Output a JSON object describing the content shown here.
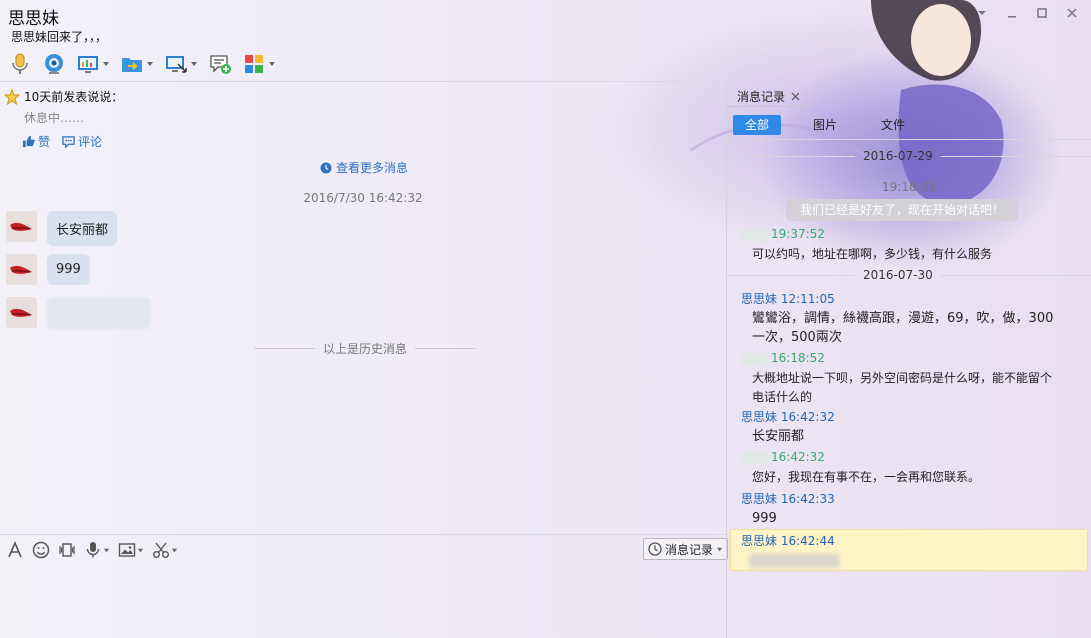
{
  "window": {
    "title": "思思妹",
    "status": "思思妹回来了，，，"
  },
  "feed": {
    "title": "10天前发表说说：",
    "text": "休息中……",
    "like_label": "赞",
    "comment_label": "评论"
  },
  "chat": {
    "more_messages_label": "查看更多消息",
    "timestamp": "2016/7/30 16:42:32",
    "messages": [
      {
        "text": "长安丽都"
      },
      {
        "text": "999"
      }
    ],
    "history_divider": "以上是历史消息"
  },
  "input": {
    "history_button_label": "消息记录"
  },
  "history_panel": {
    "tab_label": "消息记录",
    "filters": [
      "全部",
      "图片",
      "文件"
    ],
    "active_filter": "全部",
    "entries": {
      "date1": "2016-07-29",
      "sys_time": "19:18:33",
      "sys_note": "我们已经是好友了，现在开始对话吧！",
      "m1_time": "19:37:52",
      "m1_text": "可以约吗，地址在哪啊，多少钱，有什么服务",
      "date2": "2016-07-30",
      "m2_name": "思思妹",
      "m2_time": "12:11:05",
      "m2_text": "鸞鸞浴，調情，絲襪高跟，漫遊，69，吹，做，300一次，500兩次",
      "m3_time": "16:18:52",
      "m3_text": "大概地址说一下呗，另外空间密码是什么呀，能不能留个电话什么的",
      "m4_name": "思思妹",
      "m4_time": "16:42:32",
      "m4_text": "长安丽都",
      "m5_time": "16:42:32",
      "m5_text": "您好，我现在有事不在，一会再和您联系。",
      "m6_name": "思思妹",
      "m6_time": "16:42:33",
      "m6_text": "999",
      "m7_name": "思思妹",
      "m7_time": "16:42:44"
    }
  },
  "colors": {
    "accent": "#2e8ae6",
    "peer_name": "#2366b5",
    "self_name": "#3aa86b",
    "bubble": "#d9e1ec",
    "highlight": "#fff3c7"
  }
}
